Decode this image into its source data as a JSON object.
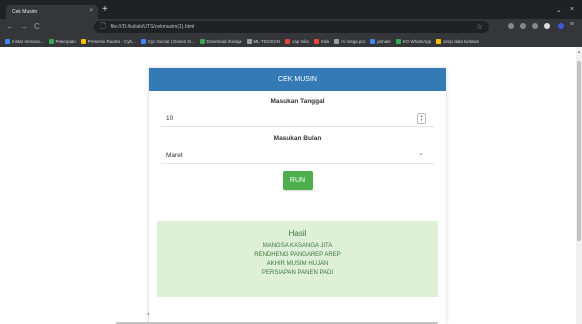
{
  "browser": {
    "tab_title": "Cek Musim",
    "tab_close": "×",
    "new_tab": "+",
    "window": {
      "minimize": "⌄",
      "close": "×"
    },
    "nav": {
      "back": "←",
      "forward": "→",
      "reload": "C"
    },
    "url": "file:///D:/kuliah/UTS/cekmusim(1).html",
    "star": "☆"
  },
  "bookmarks": [
    {
      "label": "Instar menara...",
      "color": "#4285f4"
    },
    {
      "label": "Pekerjaan",
      "color": "#34a853"
    },
    {
      "label": "Presensi Ruarta - Cyb...",
      "color": "#fbbc05"
    },
    {
      "label": "Cyc.Sociar | Dosen D...",
      "color": "#4285f4"
    },
    {
      "label": "Download /Kelaja",
      "color": "#34a853"
    },
    {
      "label": "ML-TECEGN",
      "color": "#9e9e9e"
    },
    {
      "label": "cap mila",
      "color": "#ea4335"
    },
    {
      "label": "mila",
      "color": "#ea4335"
    },
    {
      "label": "rri mega pro",
      "color": "#9e9e9e"
    },
    {
      "label": "jamale",
      "color": "#4285f4"
    },
    {
      "label": "KO WhatsApp",
      "color": "#34a853"
    },
    {
      "label": "arsip data twitwan",
      "color": "#fbbc05"
    }
  ],
  "app": {
    "header": "CEK MUSIN",
    "tanggal_label": "Masukan Tanggal",
    "tanggal_value": "10",
    "bulan_label": "Masukan Bulan",
    "bulan_value": "Maret",
    "run_label": "RUN",
    "result_title": "Hasil",
    "result_lines": [
      "MANGSA KASANGA JITA",
      "RENDHENG PANGAREP AREP",
      "AKHIR MUSIM HUJAN",
      "PERSIAPAN PANEN PADI"
    ]
  }
}
